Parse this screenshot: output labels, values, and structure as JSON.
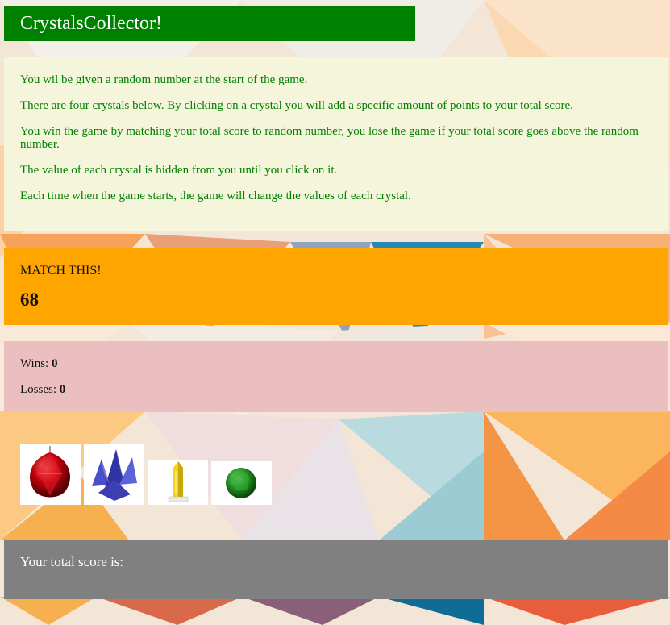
{
  "app": {
    "title": "CrystalsCollector!"
  },
  "instructions": [
    "You wil be given a random number at the start of the game.",
    "There are four crystals below. By clicking on a crystal you will add a specific amount of points to your total score.",
    "You win the game by matching your total score to random number, you lose the game if your total score goes above the random number.",
    "The value of each crystal is hidden from you until you click on it.",
    "Each time when the game starts, the game will change the values of each crystal."
  ],
  "match": {
    "label": "MATCH THIS!",
    "value": "68"
  },
  "stats": {
    "wins_label": "Wins:",
    "wins": "0",
    "losses_label": "Losses:",
    "losses": "0"
  },
  "crystals": [
    {
      "icon": "red-crystal-icon",
      "color": "#c0000b"
    },
    {
      "icon": "blue-crystal-icon",
      "color": "#3b3fb0"
    },
    {
      "icon": "yellow-crystal-icon",
      "color": "#f2d21a"
    },
    {
      "icon": "green-crystal-icon",
      "color": "#1f8a1f"
    }
  ],
  "score": {
    "label": "Your total score is:",
    "value": ""
  },
  "colors": {
    "title_bg": "#008000",
    "instructions_bg": "#f5f5dc",
    "match_bg": "#ffa500",
    "stats_bg": "#ebbfbf",
    "score_bg": "#808080"
  }
}
